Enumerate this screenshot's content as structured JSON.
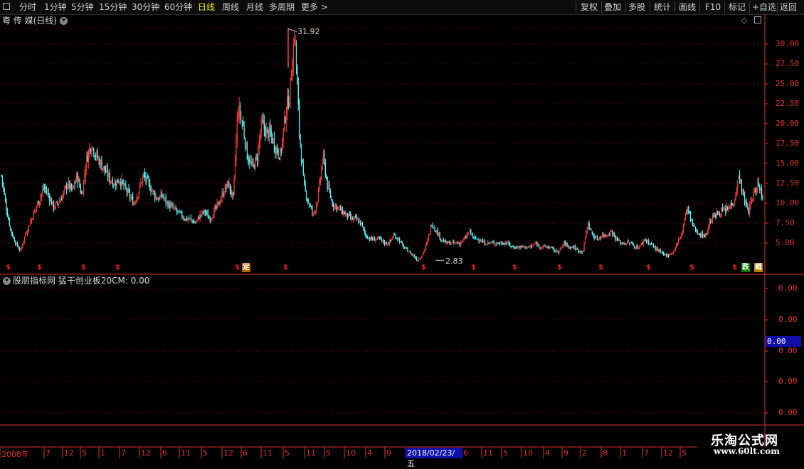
{
  "toolbar": {
    "left_items": [
      "分时",
      "1分钟",
      "5分钟",
      "15分钟",
      "30分钟",
      "60分钟",
      "日线",
      "周线",
      "月线",
      "多周期",
      "更多 >"
    ],
    "active": "日线",
    "right_items": [
      "复权",
      "叠加",
      "多股",
      "统计",
      "画线",
      "F10",
      "标记",
      "+自选",
      "返回"
    ]
  },
  "chart_title": {
    "name": "粤 传 媒(日线)",
    "more_icon": "chevron-down-icon"
  },
  "price_axis": {
    "labels": [
      "30.00",
      "27.50",
      "25.00",
      "22.50",
      "20.00",
      "17.50",
      "15.00",
      "12.50",
      "10.00",
      "7.50",
      "5.00"
    ]
  },
  "annotations": {
    "high": "31.92",
    "low": "2.83"
  },
  "event_flags": {
    "s_symbol": "$",
    "ding": "定",
    "die": "跌",
    "gai": "概"
  },
  "indicator": {
    "title": "股朋指标网",
    "name_value": "猛干创业板20CM: 0.00",
    "axis_labels": [
      "0.00",
      "0.00",
      "0.00",
      "0.00",
      "0.00"
    ],
    "current": "0.00"
  },
  "date_axis": {
    "labels": [
      "2008年",
      "7",
      "12",
      "5",
      "1",
      "7",
      "12",
      "6",
      "11",
      "5",
      "12",
      "6",
      "11",
      "5",
      "11",
      "5",
      "10",
      "4",
      "9",
      "6",
      "11",
      "5",
      "10",
      "4",
      "9",
      "2",
      "8",
      "1",
      "7",
      "12",
      "5"
    ],
    "selected": "2018/02/23/五"
  },
  "watermark": {
    "line1": "乐淘公式网",
    "line2": "www.60lt.com"
  },
  "colors": {
    "up": "#ff3b3b",
    "down": "#54ffff",
    "grid": "#7a0000",
    "axis": "#e03030",
    "selection": "#1010a8"
  },
  "chart_data": {
    "type": "line",
    "title": "粤 传 媒(日线)",
    "ylim": [
      2.0,
      33.0
    ],
    "series": [
      {
        "values": [
          13.5,
          9.5,
          6.5,
          5.0,
          4.0,
          6.0,
          7.5,
          9.0,
          10.5,
          12.0,
          11.0,
          9.5,
          10.0,
          11.0,
          12.5,
          11.5,
          13.5,
          11.0,
          15.5,
          17.5,
          16.0,
          15.0,
          14.0,
          13.0,
          12.5,
          13.0,
          12.0,
          11.0,
          10.0,
          11.5,
          13.5,
          12.5,
          11.5,
          10.5,
          11.0,
          10.0,
          9.5,
          9.0,
          8.5,
          8.0,
          8.0,
          7.5,
          8.5,
          9.0,
          8.0,
          9.0,
          10.0,
          11.5,
          12.5,
          10.5,
          22.0,
          20.0,
          16.0,
          14.5,
          15.5,
          20.0,
          19.0,
          18.5,
          17.0,
          16.0,
          21.0,
          24.0,
          31.9,
          19.0,
          12.0,
          10.0,
          8.5,
          11.0,
          16.0,
          12.0,
          10.0,
          9.5,
          9.0,
          8.5,
          8.0,
          8.0,
          7.5,
          6.0,
          5.5,
          5.5,
          5.5,
          5.0,
          5.0,
          6.0,
          5.5,
          4.5,
          4.0,
          3.5,
          2.9,
          3.5,
          5.0,
          7.5,
          6.5,
          5.5,
          5.0,
          5.0,
          5.0,
          5.0,
          5.5,
          6.5,
          5.5,
          5.5,
          5.0,
          5.0,
          5.0,
          5.0,
          5.0,
          5.0,
          4.5,
          4.5,
          4.5,
          4.5,
          4.5,
          5.0,
          4.5,
          4.5,
          4.5,
          4.0,
          4.0,
          5.0,
          4.5,
          4.5,
          4.0,
          4.0,
          7.5,
          6.0,
          5.5,
          6.0,
          6.0,
          6.5,
          5.5,
          5.0,
          5.0,
          5.0,
          4.5,
          4.5,
          5.5,
          5.0,
          4.5,
          4.0,
          3.5,
          3.5,
          3.8,
          5.0,
          6.5,
          9.5,
          7.5,
          6.5,
          6.0,
          6.0,
          8.0,
          8.5,
          9.0,
          9.0,
          9.5,
          10.5,
          13.5,
          10.5,
          9.0,
          11.0,
          12.5,
          11.0
        ]
      }
    ]
  }
}
